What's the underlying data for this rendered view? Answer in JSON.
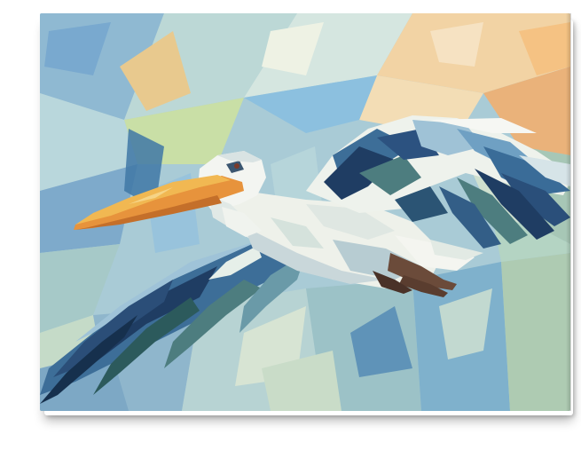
{
  "artwork": {
    "subject": "pelican-in-flight",
    "style": "cubist-geometric-painting",
    "palette": {
      "sky_light": "#cfe3e6",
      "sky_blue": "#7fb0cf",
      "sky_deep": "#4f86ad",
      "sky_green": "#b9d3a8",
      "sky_peach": "#f0c691",
      "sky_orange": "#e9a86b",
      "feather_white": "#f1f3ee",
      "feather_shadow": "#c9d7da",
      "wing_navy": "#1f3d63",
      "wing_blue": "#3d6e98",
      "wing_teal": "#4d7d7f",
      "beak_orange": "#e7933c",
      "beak_yellow": "#f1b852",
      "leg_brown": "#6b4b3a"
    }
  }
}
